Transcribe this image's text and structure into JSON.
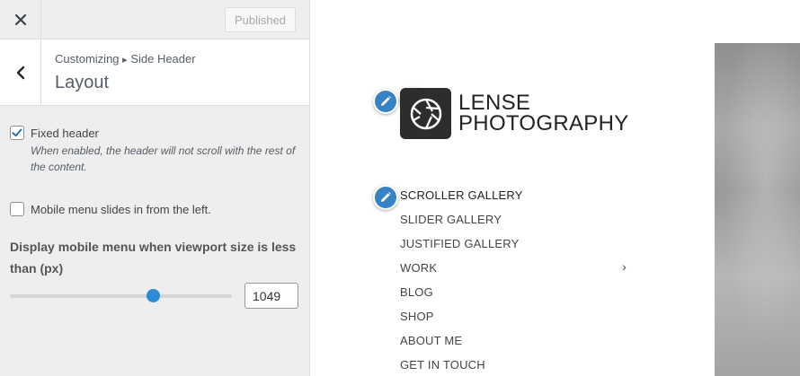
{
  "topbar": {
    "close_icon": "close-icon",
    "publish_label": "Published"
  },
  "section": {
    "back_icon": "chevron-left-icon",
    "breadcrumb_parent": "Customizing",
    "breadcrumb_separator": "▸",
    "breadcrumb_current": "Side Header",
    "title": "Layout"
  },
  "controls": {
    "fixed_header": {
      "label": "Fixed header",
      "checked": true,
      "description": "When enabled, the header will not scroll with the rest of the content."
    },
    "mobile_menu_left": {
      "label": "Mobile menu slides in from the left.",
      "checked": false
    },
    "mobile_breakpoint": {
      "label": "Display mobile menu when viewport size is less than (px)",
      "value": "1049",
      "slider_fraction": 0.64
    }
  },
  "preview": {
    "logo_line1": "LENSE",
    "logo_line2": "PHOTOGRAPHY",
    "logo_icon": "camera-aperture-icon",
    "edit_icon": "pencil-icon",
    "menu": [
      {
        "label": "SCROLLER GALLERY",
        "current": true
      },
      {
        "label": "SLIDER GALLERY"
      },
      {
        "label": "JUSTIFIED GALLERY"
      },
      {
        "label": "WORK",
        "has_submenu": true,
        "submenu_icon": "chevron-right-icon"
      },
      {
        "label": "BLOG"
      },
      {
        "label": "SHOP"
      },
      {
        "label": "ABOUT ME"
      },
      {
        "label": "GET IN TOUCH"
      }
    ]
  },
  "colors": {
    "accent": "#2a8bd7",
    "edit_pencil": "#3582c4",
    "sidebar_bg": "#eeeeee"
  }
}
